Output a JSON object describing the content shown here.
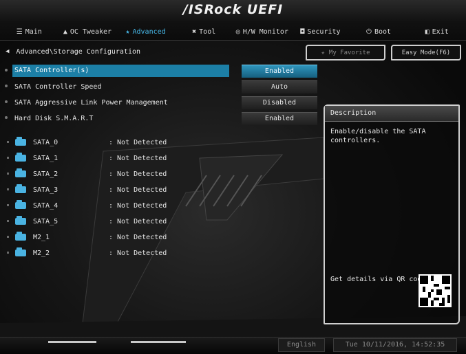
{
  "header": {
    "brand": "/ISRock UEFI"
  },
  "menu": [
    {
      "label": "Main",
      "icon": "list-icon",
      "glyph": "☰",
      "active": false
    },
    {
      "label": "OC Tweaker",
      "icon": "rocket-icon",
      "glyph": "▲",
      "active": false
    },
    {
      "label": "Advanced",
      "icon": "star-icon",
      "glyph": "★",
      "active": true
    },
    {
      "label": "Tool",
      "icon": "tools-icon",
      "glyph": "✖",
      "active": false
    },
    {
      "label": "H/W Monitor",
      "icon": "monitor-icon",
      "glyph": "◎",
      "active": false
    },
    {
      "label": "Security",
      "icon": "shield-icon",
      "glyph": "◘",
      "active": false
    },
    {
      "label": "Boot",
      "icon": "power-icon",
      "glyph": "⏻",
      "active": false
    },
    {
      "label": "Exit",
      "icon": "exit-icon",
      "glyph": "◧",
      "active": false
    }
  ],
  "breadcrumb": "Advanced\\Storage Configuration",
  "buttons": {
    "favorite": "My Favorite",
    "easy_mode": "Easy Mode(F6)"
  },
  "options": [
    {
      "label": "SATA Controller(s)",
      "value": "Enabled",
      "selected": true
    },
    {
      "label": "SATA Controller Speed",
      "value": "Auto",
      "selected": false
    },
    {
      "label": "SATA Aggressive Link Power Management",
      "value": "Disabled",
      "selected": false
    },
    {
      "label": "Hard Disk S.M.A.R.T",
      "value": "Enabled",
      "selected": false
    }
  ],
  "devices": [
    {
      "name": "SATA_0",
      "status": ": Not Detected"
    },
    {
      "name": "SATA_1",
      "status": ": Not Detected"
    },
    {
      "name": "SATA_2",
      "status": ": Not Detected"
    },
    {
      "name": "SATA_3",
      "status": ": Not Detected"
    },
    {
      "name": "SATA_4",
      "status": ": Not Detected"
    },
    {
      "name": "SATA_5",
      "status": ": Not Detected"
    },
    {
      "name": "M2_1",
      "status": ": Not Detected"
    },
    {
      "name": "M2_2",
      "status": ": Not Detected"
    }
  ],
  "description": {
    "title": "Description",
    "text": "Enable/disable the SATA\ncontrollers.",
    "qr_label": "Get details via QR code"
  },
  "footer": {
    "language": "English",
    "datetime": "Tue 10/11/2016, 14:52:35"
  },
  "colors": {
    "accent": "#47b8e8",
    "selected_bg": "#1c7fa6"
  }
}
